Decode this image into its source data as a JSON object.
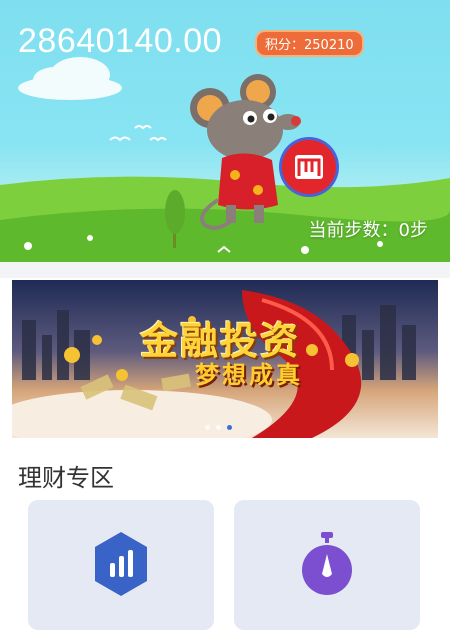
{
  "header": {
    "balance": "28640140.00",
    "points_badge": "积分：250210",
    "steps_text": "当前步数：0步",
    "coin_logo": "m-coin-icon"
  },
  "banner": {
    "headline": "金融投资",
    "subline": "梦想成真",
    "carousel": {
      "slides": 3,
      "active": 3
    }
  },
  "finance": {
    "section_title": "理财专区",
    "cards": [
      {
        "icon": "bar-chart-hexagon-icon",
        "color": "#3a63c7"
      },
      {
        "icon": "stopwatch-icon",
        "color": "#7b4fd0"
      }
    ]
  },
  "colors": {
    "sky": "#88e4f2",
    "grass": "#7ed23f",
    "badge": "#ee6c3a",
    "card_bg": "#e5e9f3"
  }
}
